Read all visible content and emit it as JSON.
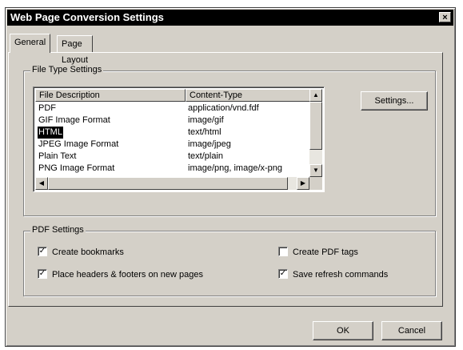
{
  "window": {
    "title": "Web Page Conversion Settings",
    "close_glyph": "×"
  },
  "tabs": [
    {
      "label": "General",
      "active": true
    },
    {
      "label": "Page Layout",
      "active": false
    }
  ],
  "file_type_settings": {
    "group_label": "File Type Settings",
    "columns": [
      "File Description",
      "Content-Type"
    ],
    "rows": [
      {
        "description": "PDF",
        "content_type": "application/vnd.fdf"
      },
      {
        "description": "GIF Image Format",
        "content_type": "image/gif"
      },
      {
        "description": "HTML",
        "content_type": "text/html",
        "selected": true
      },
      {
        "description": "JPEG Image Format",
        "content_type": "image/jpeg"
      },
      {
        "description": "Plain Text",
        "content_type": "text/plain"
      },
      {
        "description": "PNG Image Format",
        "content_type": "image/png, image/x-png"
      }
    ],
    "settings_button": "Settings..."
  },
  "pdf_settings": {
    "group_label": "PDF Settings",
    "options": [
      {
        "label": "Create bookmarks",
        "checked": true
      },
      {
        "label": "Create PDF tags",
        "checked": false
      },
      {
        "label": "Place headers & footers on new pages",
        "checked": true
      },
      {
        "label": "Save refresh commands",
        "checked": true
      }
    ]
  },
  "buttons": {
    "ok": "OK",
    "cancel": "Cancel"
  },
  "colors": {
    "dialog_face": "#d4d0c8",
    "title_bar": "#000000",
    "selection": "#000000"
  }
}
